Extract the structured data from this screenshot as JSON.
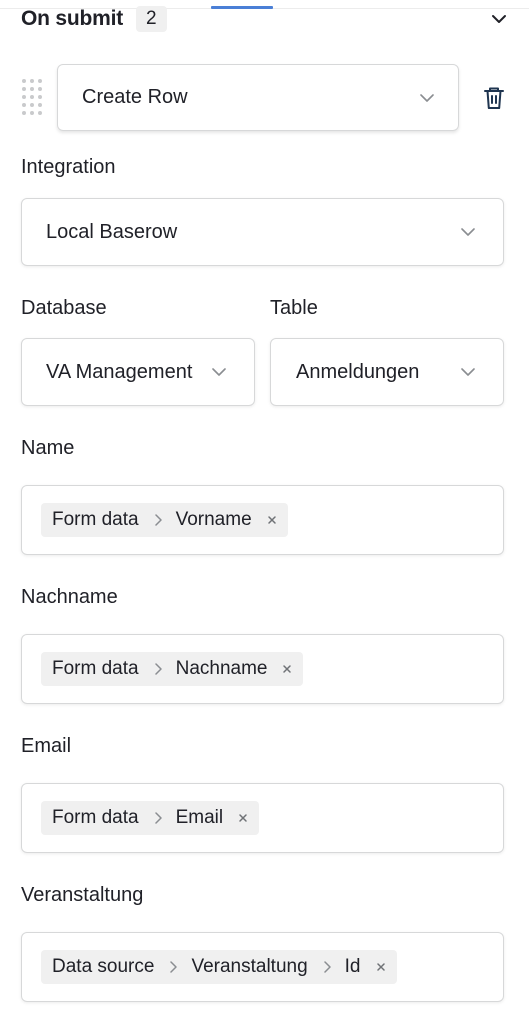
{
  "header": {
    "title": "On submit",
    "count": "2"
  },
  "action": {
    "type": "Create Row"
  },
  "integration": {
    "label": "Integration",
    "value": "Local Baserow"
  },
  "database": {
    "label": "Database",
    "value": "VA Management"
  },
  "table": {
    "label": "Table",
    "value": "Anmeldungen"
  },
  "fields": [
    {
      "label": "Name",
      "path": [
        "Form data",
        "Vorname"
      ]
    },
    {
      "label": "Nachname",
      "path": [
        "Form data",
        "Nachname"
      ]
    },
    {
      "label": "Email",
      "path": [
        "Form data",
        "Email"
      ]
    },
    {
      "label": "Veranstaltung",
      "path": [
        "Data source",
        "Veranstaltung",
        "Id"
      ]
    }
  ],
  "colors": {
    "accent": "#4a7fd6",
    "border": "#d7d8d9",
    "chip": "#f0f0f0",
    "text": "#202128",
    "icon": "#1f3550"
  }
}
